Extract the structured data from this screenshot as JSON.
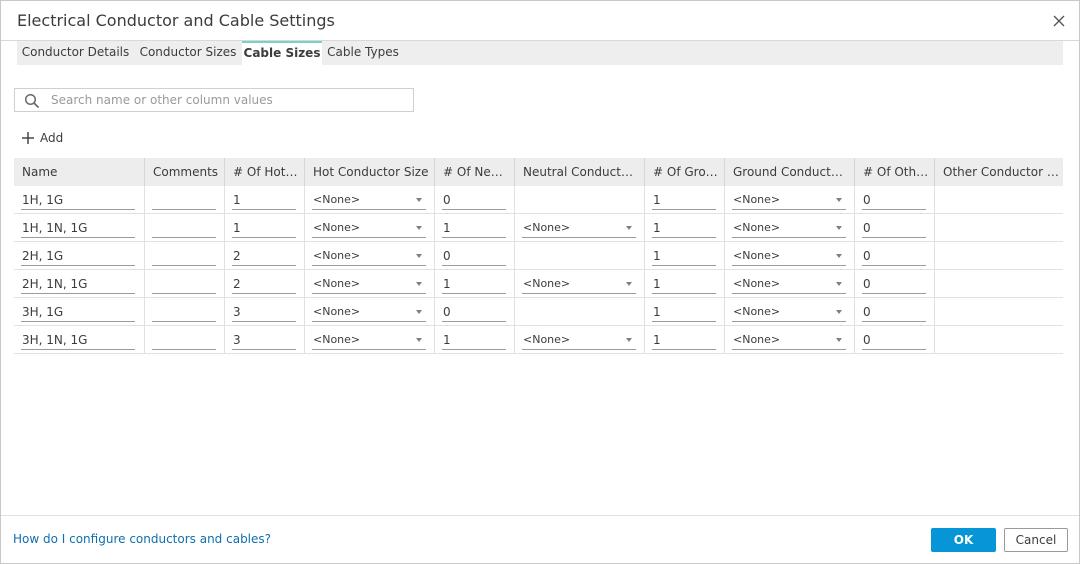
{
  "dialog": {
    "title": "Electrical Conductor and Cable Settings"
  },
  "tabs": [
    {
      "label": "Conductor Details",
      "active": false
    },
    {
      "label": "Conductor Sizes",
      "active": false
    },
    {
      "label": "Cable Sizes",
      "active": true
    },
    {
      "label": "Cable Types",
      "active": false
    }
  ],
  "search": {
    "placeholder": "Search name or other column values",
    "value": ""
  },
  "toolbar": {
    "add_label": "Add"
  },
  "table": {
    "columns": [
      "Name",
      "Comments",
      "# Of Hot C...",
      "Hot Conductor Size",
      "# Of Neut...",
      "Neutral Conductor ...",
      "# Of Grou...",
      "Ground Conductor ...",
      "# Of Othe...",
      "Other Conductor Si..."
    ],
    "rows": [
      {
        "name": "1H, 1G",
        "comments": "",
        "hot_count": "1",
        "hot_size": "<None>",
        "neutral_count": "0",
        "neutral_size": null,
        "ground_count": "1",
        "ground_size": "<None>",
        "other_count": "0",
        "other_size": ""
      },
      {
        "name": "1H, 1N, 1G",
        "comments": "",
        "hot_count": "1",
        "hot_size": "<None>",
        "neutral_count": "1",
        "neutral_size": "<None>",
        "ground_count": "1",
        "ground_size": "<None>",
        "other_count": "0",
        "other_size": ""
      },
      {
        "name": "2H, 1G",
        "comments": "",
        "hot_count": "2",
        "hot_size": "<None>",
        "neutral_count": "0",
        "neutral_size": null,
        "ground_count": "1",
        "ground_size": "<None>",
        "other_count": "0",
        "other_size": ""
      },
      {
        "name": "2H, 1N, 1G",
        "comments": "",
        "hot_count": "2",
        "hot_size": "<None>",
        "neutral_count": "1",
        "neutral_size": "<None>",
        "ground_count": "1",
        "ground_size": "<None>",
        "other_count": "0",
        "other_size": ""
      },
      {
        "name": "3H, 1G",
        "comments": "",
        "hot_count": "3",
        "hot_size": "<None>",
        "neutral_count": "0",
        "neutral_size": null,
        "ground_count": "1",
        "ground_size": "<None>",
        "other_count": "0",
        "other_size": ""
      },
      {
        "name": "3H, 1N, 1G",
        "comments": "",
        "hot_count": "3",
        "hot_size": "<None>",
        "neutral_count": "1",
        "neutral_size": "<None>",
        "ground_count": "1",
        "ground_size": "<None>",
        "other_count": "0",
        "other_size": ""
      }
    ]
  },
  "footer": {
    "help_link": "How do I configure conductors and cables?",
    "ok_label": "OK",
    "cancel_label": "Cancel"
  },
  "colors": {
    "accent": "#0696d7",
    "link": "#0f6fad",
    "active_tab_indicator": "#7ad1c6",
    "header_bg": "#ededed"
  },
  "icons": {
    "close": "close-icon",
    "search": "search-icon",
    "add": "plus-icon",
    "dropdown": "chevron-down-icon"
  }
}
